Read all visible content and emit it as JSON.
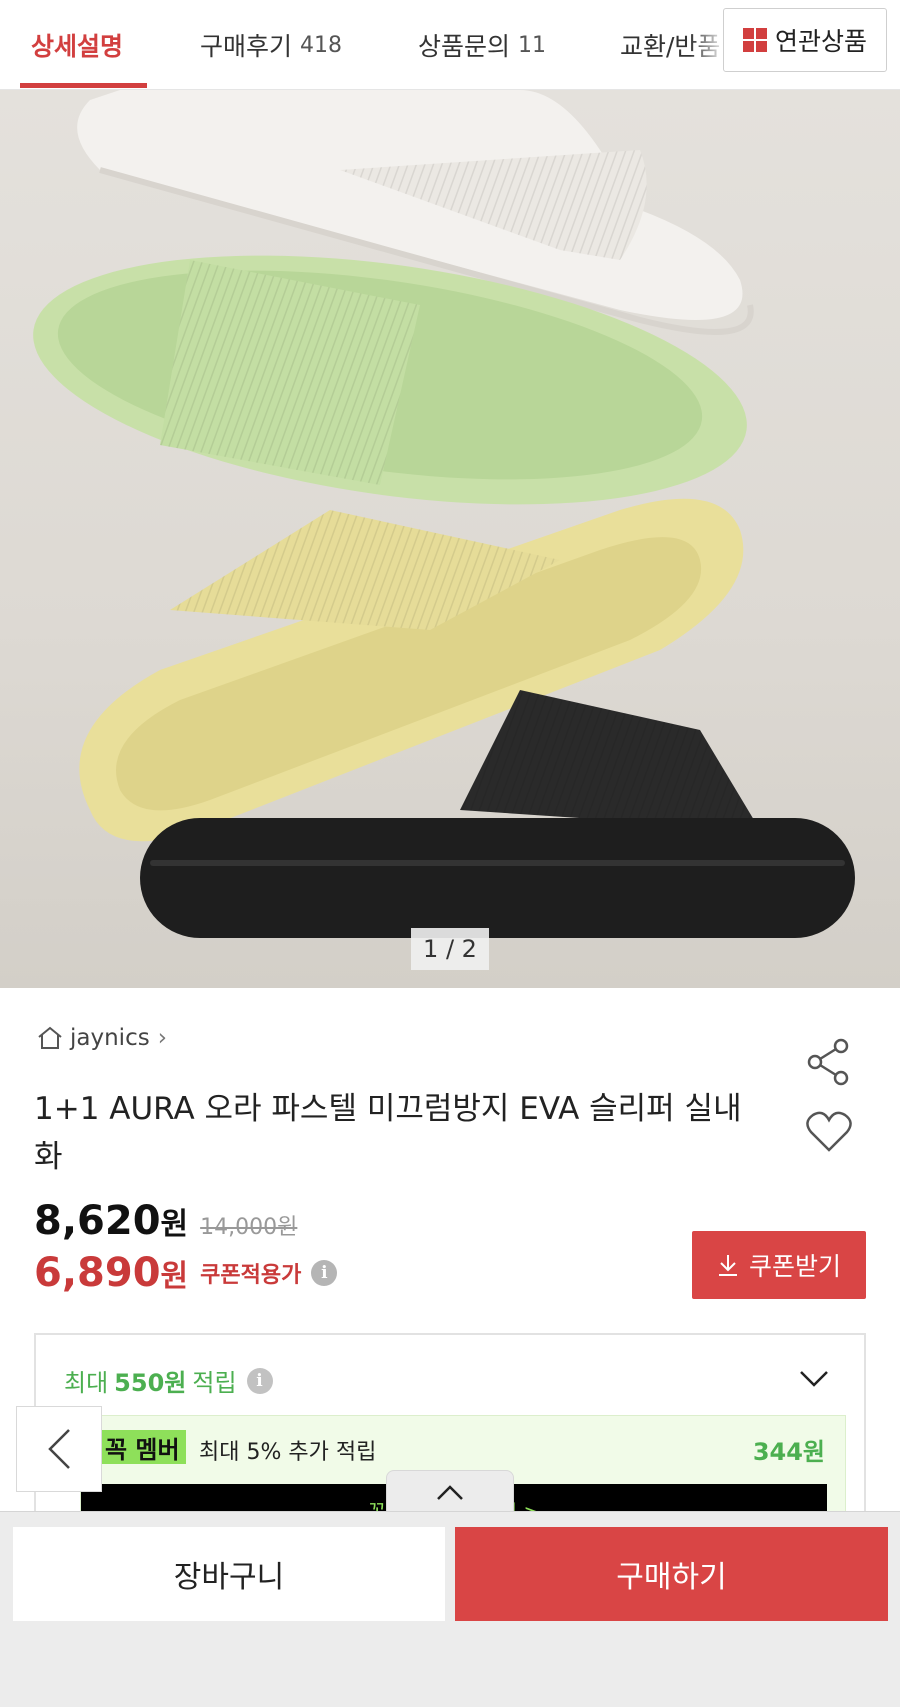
{
  "tabs": [
    {
      "label": "상세설명",
      "count": ""
    },
    {
      "label": "구매후기",
      "count": "418"
    },
    {
      "label": "상품문의",
      "count": "11"
    },
    {
      "label": "교환/반품",
      "count": ""
    }
  ],
  "related_button": {
    "label": "연관상품",
    "icon": "grid-icon"
  },
  "hero": {
    "counter": "1 / 2"
  },
  "product": {
    "store": "jaynics",
    "title": "1+1 AURA 오라 파스텔 미끄럼방지 EVA 슬리퍼 실내화",
    "price": "8,620",
    "price_unit": "원",
    "original_price": "14,000원",
    "coupon_price": "6,890",
    "coupon_unit": "원",
    "coupon_note": "쿠폰적용가",
    "coupon_button": "쿠폰받기"
  },
  "points": {
    "prefix": "최대",
    "amount": "550원",
    "suffix": "적립",
    "member_badge": "꼭 멤버",
    "member_text": "최대 5% 추가 적립",
    "member_amount": "344원",
    "member_link": "꼭! 시작하고 받기 >"
  },
  "bottom": {
    "cart": "장바구니",
    "buy": "구매하기"
  },
  "colors": {
    "accent": "#d23f3f",
    "button_red": "#d94545",
    "point_green": "#4caf50",
    "member_green": "#8ee05a"
  }
}
